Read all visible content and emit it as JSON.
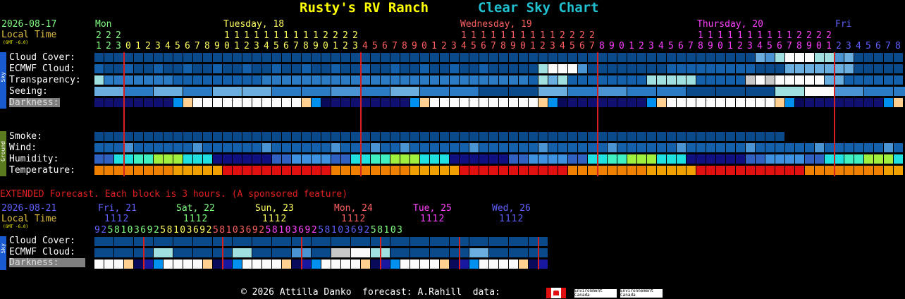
{
  "header": {
    "site_title": "Rusty's RV Ranch",
    "chart_title": "Clear Sky Chart",
    "site_color": "#ffff00",
    "chart_color": "#20c0d0"
  },
  "main": {
    "date": "2026-08-17",
    "local_time": "Local Time",
    "gmt": "(GMT -6.0)",
    "days": [
      {
        "label": "Mon",
        "color": "#80ff80"
      },
      {
        "label": "Tuesday, 18",
        "color": "#ffff60"
      },
      {
        "label": "Wednesday, 19",
        "color": "#ff6060"
      },
      {
        "label": "Thursday, 20",
        "color": "#ff40ff"
      },
      {
        "label": "Fri",
        "color": "#6060ff"
      }
    ],
    "sky_tab": "Sky",
    "ground_tab": "Ground",
    "sky_rows": [
      "Cloud Cover:",
      "ECMWF Cloud:",
      "Transparency:",
      "Seeing:",
      "Darkness:"
    ],
    "ground_rows": [
      "Smoke:",
      "Wind:",
      "Humidity:",
      "Temperature:"
    ]
  },
  "extended": {
    "notice": "EXTENDED Forecast. Each block is 3 hours. (A sponsored feature)",
    "date": "2026-08-21",
    "local_time": "Local Time",
    "gmt": "(GMT -6.0)",
    "days": [
      {
        "label": "Fri, 21",
        "color": "#6060ff"
      },
      {
        "label": "Sat, 22",
        "color": "#80ff80"
      },
      {
        "label": "Sun, 23",
        "color": "#ffff60"
      },
      {
        "label": "Mon, 24",
        "color": "#ff6060"
      },
      {
        "label": "Tue, 25",
        "color": "#ff40ff"
      },
      {
        "label": "Wed, 26",
        "color": "#6060ff"
      }
    ],
    "sky_tab": "Sky",
    "rows": [
      "Cloud Cover:",
      "ECMWF Cloud:",
      "Darkness:"
    ],
    "hours": "92581036925810369258103692581036925810369258103"
  },
  "footer": {
    "credit": "© 2026 Attilla Danko  forecast: A.Rahill  data:",
    "env1": "Environment\nCanada",
    "env2": "Environnement\nCanada"
  }
}
